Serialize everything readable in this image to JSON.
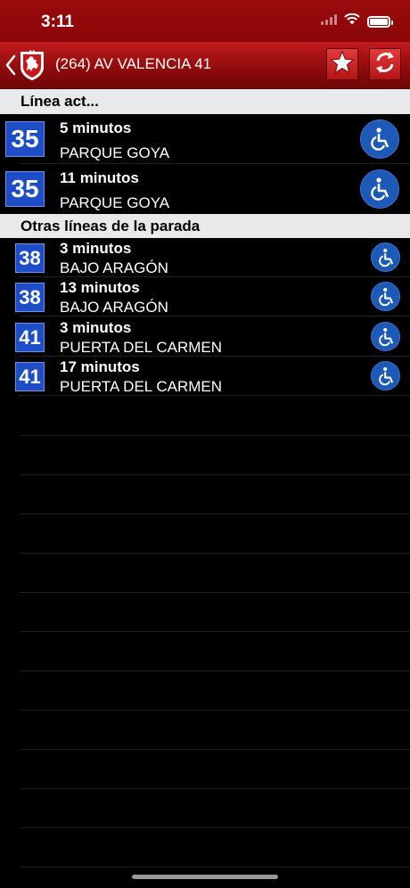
{
  "status_bar": {
    "time": "3:11"
  },
  "navbar": {
    "title": "(264) AV VALENCIA 41"
  },
  "sections": {
    "current": "Línea act...",
    "others": "Otras líneas de la parada"
  },
  "current_lines": [
    {
      "line": "35",
      "minutes": "5 minutos",
      "destination": "PARQUE GOYA"
    },
    {
      "line": "35",
      "minutes": "11 minutos",
      "destination": "PARQUE GOYA"
    }
  ],
  "other_lines": [
    {
      "line": "38",
      "minutes": "3 minutos",
      "destination": "BAJO ARAGÓN"
    },
    {
      "line": "38",
      "minutes": "13 minutos",
      "destination": "BAJO ARAGÓN"
    },
    {
      "line": "41",
      "minutes": "3 minutos",
      "destination": "PUERTA DEL CARMEN"
    },
    {
      "line": "41",
      "minutes": "17 minutos",
      "destination": "PUERTA DEL CARMEN"
    }
  ],
  "colors": {
    "header_red": "#b51416",
    "badge_blue": "#1e4ec7",
    "wheelchair_blue": "#1d5ab7",
    "section_bg": "#e9e9eb"
  },
  "icons": [
    "wifi-icon",
    "battery-icon",
    "back-chevron-icon",
    "zaragoza-crest-icon",
    "star-icon",
    "refresh-icon",
    "wheelchair-icon"
  ]
}
